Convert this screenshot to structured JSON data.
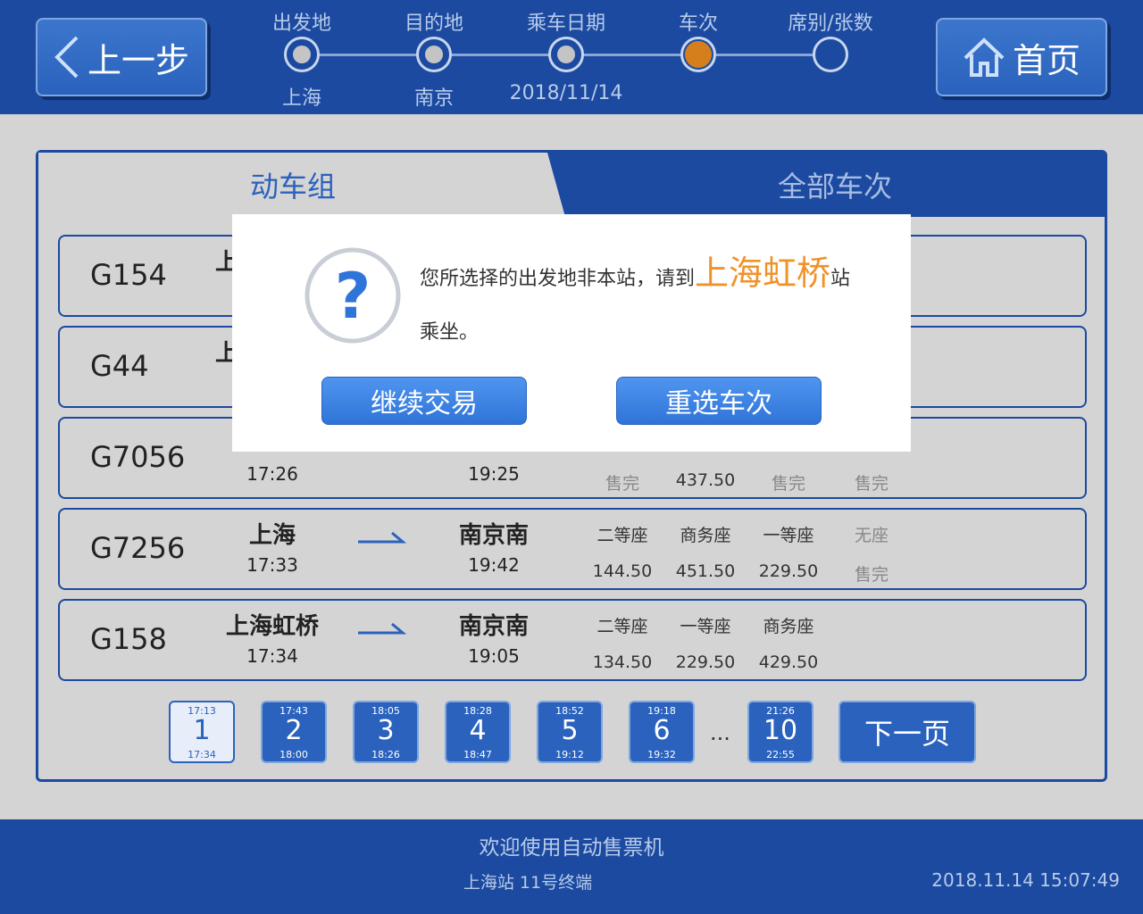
{
  "header": {
    "back_label": "上一步",
    "home_label": "首页",
    "steps": [
      {
        "label": "出发地",
        "value": "上海",
        "state": "done"
      },
      {
        "label": "目的地",
        "value": "南京",
        "state": "done"
      },
      {
        "label": "乘车日期",
        "value": "2018/11/14",
        "state": "done"
      },
      {
        "label": "车次",
        "value": "",
        "state": "current"
      },
      {
        "label": "席别/张数",
        "value": "",
        "state": "pending"
      }
    ]
  },
  "tabs": {
    "active": "动车组",
    "other": "全部车次"
  },
  "trains": [
    {
      "no": "G154",
      "from": "上",
      "dep": "",
      "to": "",
      "arr": "",
      "seats": []
    },
    {
      "no": "G44",
      "from": "上",
      "dep": "",
      "to": "",
      "arr": "",
      "seats": []
    },
    {
      "no": "G7056",
      "from": "",
      "dep": "17:26",
      "to": "",
      "arr": "19:25",
      "seats": [
        {
          "name": "",
          "price": "售完"
        },
        {
          "name": "",
          "price": "437.50"
        },
        {
          "name": "",
          "price": "售完"
        },
        {
          "name": "",
          "price": "售完"
        }
      ]
    },
    {
      "no": "G7256",
      "from": "上海",
      "dep": "17:33",
      "to": "南京南",
      "arr": "19:42",
      "seats": [
        {
          "name": "二等座",
          "price": "144.50"
        },
        {
          "name": "商务座",
          "price": "451.50"
        },
        {
          "name": "一等座",
          "price": "229.50"
        },
        {
          "name": "无座",
          "price": "售完"
        }
      ]
    },
    {
      "no": "G158",
      "from": "上海虹桥",
      "dep": "17:34",
      "to": "南京南",
      "arr": "19:05",
      "seats": [
        {
          "name": "二等座",
          "price": "134.50"
        },
        {
          "name": "一等座",
          "price": "229.50"
        },
        {
          "name": "商务座",
          "price": "429.50"
        }
      ]
    }
  ],
  "pager": {
    "pages": [
      {
        "n": "1",
        "start": "17:13",
        "end": "17:34",
        "active": true
      },
      {
        "n": "2",
        "start": "17:43",
        "end": "18:00"
      },
      {
        "n": "3",
        "start": "18:05",
        "end": "18:26"
      },
      {
        "n": "4",
        "start": "18:28",
        "end": "18:47"
      },
      {
        "n": "5",
        "start": "18:52",
        "end": "19:12"
      },
      {
        "n": "6",
        "start": "19:18",
        "end": "19:32"
      },
      {
        "n": "10",
        "start": "21:26",
        "end": "22:55"
      }
    ],
    "ellipsis": "...",
    "next_label": "下一页"
  },
  "modal": {
    "msg_before": "您所选择的出发地非本站，请到",
    "station": "上海虹桥",
    "msg_after": "站乘坐。",
    "continue_label": "继续交易",
    "reselect_label": "重选车次"
  },
  "footer": {
    "welcome": "欢迎使用自动售票机",
    "station": "上海站 11号终端",
    "datetime": "2018.11.14   15:07:49"
  },
  "colors": {
    "primary": "#1b4aa0",
    "button": "#2a62bd",
    "highlight": "#f0922a",
    "current_step": "#d47f1c"
  }
}
